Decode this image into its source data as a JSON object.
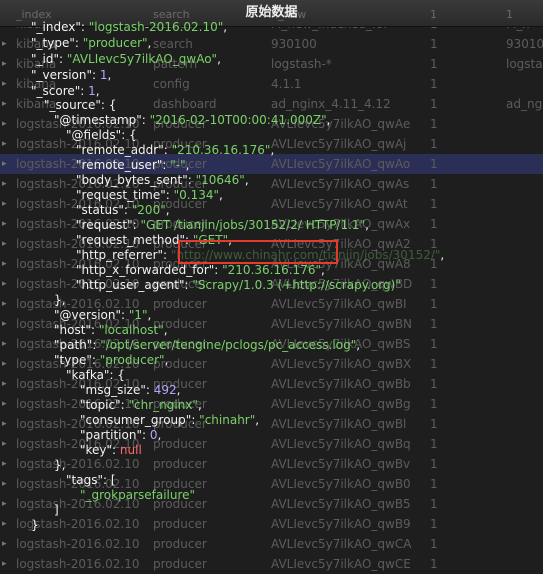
{
  "header": {
    "title": "原始数据",
    "col_index": "_index",
    "col_type": "search",
    "col_id": "h_new",
    "col_version": "1",
    "col_score": "1"
  },
  "table_rows": [
    {
      "index": "kibana",
      "type": "search",
      "id": "M_new_Indexed_for",
      "v": "1",
      "s": "M_x"
    },
    {
      "index": "kibana",
      "type": "search",
      "id": "930100",
      "v": "1",
      "s": "93010"
    },
    {
      "index": "kibana",
      "type": "pattern",
      "id": "logstash-*",
      "v": "1",
      "s": "logstash"
    },
    {
      "index": "kibana",
      "type": "config",
      "id": "4.1.1",
      "v": "1",
      "s": ""
    },
    {
      "index": "kibana",
      "type": "dashboard",
      "id": "ad_nginx_4.11_4.12",
      "v": "1",
      "s": "ad_ngin"
    },
    {
      "index": "logstash-2016.02.10",
      "type": "producer",
      "id": "AVLIevc5y7ilkAO_qwAe",
      "v": "1",
      "s": ""
    },
    {
      "index": "logstash-2016.02.10",
      "type": "producer",
      "id": "AVLIevc5y7ilkAO_qwAj",
      "v": "1",
      "s": ""
    },
    {
      "index": "logstash-2016.02.10",
      "type": "producer",
      "id": "AVLIevc5y7ilkAO_qwAo",
      "v": "1",
      "s": ""
    },
    {
      "index": "logstash-2016.02.10",
      "type": "producer",
      "id": "AVLIevc5y7ilkAO_qwAs",
      "v": "1",
      "s": ""
    },
    {
      "index": "logstash-2016.02.10",
      "type": "producer",
      "id": "AVLIevc5y7ilkAO_qwAt",
      "v": "1",
      "s": ""
    },
    {
      "index": "logstash-2016.02.10",
      "type": "producer",
      "id": "AVLIevc5y7ilkAO_qwAx",
      "v": "1",
      "s": ""
    },
    {
      "index": "logstash-2016.02.10",
      "type": "producer",
      "id": "AVLIevc5y7ilkAO_qwA2",
      "v": "1",
      "s": ""
    },
    {
      "index": "logstash-2016.02.10",
      "type": "producer",
      "id": "AVLIevc5y7ilkAO_qwA8",
      "v": "1",
      "s": ""
    },
    {
      "index": "logstash-2016.02.10",
      "type": "producer",
      "id": "AVLIevc5y7ilkAO_qwBD",
      "v": "1",
      "s": ""
    },
    {
      "index": "logstash-2016.02.10",
      "type": "producer",
      "id": "AVLIevc5y7ilkAO_qwBI",
      "v": "1",
      "s": ""
    },
    {
      "index": "logstash-2016.02.10",
      "type": "producer",
      "id": "AVLIevc5y7ilkAO_qwBN",
      "v": "1",
      "s": ""
    },
    {
      "index": "logstash-2016.02.10",
      "type": "producer",
      "id": "AVLIevc5y7ilkAO_qwBS",
      "v": "1",
      "s": ""
    },
    {
      "index": "logstash-2016.02.10",
      "type": "producer",
      "id": "AVLIevc5y7ilkAO_qwBX",
      "v": "1",
      "s": ""
    },
    {
      "index": "logstash-2016.02.10",
      "type": "producer",
      "id": "AVLIevc5y7ilkAO_qwBb",
      "v": "1",
      "s": ""
    },
    {
      "index": "logstash-2016.02.10",
      "type": "producer",
      "id": "AVLIevc5y7ilkAO_qwBg",
      "v": "1",
      "s": ""
    },
    {
      "index": "logstash-2016.02.10",
      "type": "producer",
      "id": "AVLIevc5y7ilkAO_qwBl",
      "v": "1",
      "s": ""
    },
    {
      "index": "logstash-2016.02.10",
      "type": "producer",
      "id": "AVLIevc5y7ilkAO_qwBq",
      "v": "1",
      "s": ""
    },
    {
      "index": "logstash-2016.02.10",
      "type": "producer",
      "id": "AVLIevc5y7ilkAO_qwBv",
      "v": "1",
      "s": ""
    },
    {
      "index": "logstash-2016.02.10",
      "type": "producer",
      "id": "AVLIevc5y7ilkAO_qwB0",
      "v": "1",
      "s": ""
    },
    {
      "index": "logstash-2016.02.10",
      "type": "producer",
      "id": "AVLIevc5y7ilkAO_qwB5",
      "v": "1",
      "s": ""
    },
    {
      "index": "logstash-2016.02.10",
      "type": "producer",
      "id": "AVLIevc5y7ilkAO_qwB9",
      "v": "1",
      "s": ""
    },
    {
      "index": "logstash-2016.02.10",
      "type": "producer",
      "id": "AVLIevc5y7ilkAO_qwCA",
      "v": "1",
      "s": ""
    },
    {
      "index": "logstash-2016.02.10",
      "type": "producer",
      "id": "AVLIevc5y7ilkAO_qwCE",
      "v": "1",
      "s": ""
    }
  ],
  "json": {
    "index_key": "\"_index\"",
    "index_val": "\"logstash-2016.02.10\"",
    "type_key": "\"_type\"",
    "type_val": "\"producer\"",
    "id_key": "\"_id\"",
    "id_val": "\"AVLIevc5y7ilkAO_qwAo\"",
    "version_key": "\"_version\"",
    "version_val": "1",
    "score_key": "\"_score\"",
    "score_val": "1",
    "source_key": "\"_source\"",
    "timestamp_key": "\"@timestamp\"",
    "timestamp_val": "\"2016-02-10T00:00:41.000Z\"",
    "fields_key": "\"@fields\"",
    "remote_addr_key": "\"remote_addr\"",
    "remote_addr_val": "\"210.36.16.176\"",
    "remote_user_key": "\"remote_user\"",
    "remote_user_val": "\"-\"",
    "body_bytes_key": "\"body_bytes_sent\"",
    "body_bytes_val": "\"10646\"",
    "request_time_key": "\"request_time\"",
    "request_time_val": "\"0.134\"",
    "status_key": "\"status\"",
    "status_val": "\"200\"",
    "request_key": "\"request\"",
    "request_val": "\"GET /tianjin/jobs/30152/2/ HTTP/1.1\"",
    "request_method_key": "\"request_method\"",
    "request_method_val": "\"GET\"",
    "http_referrer_key": "\"http_referrer\"",
    "http_referrer_val": "\"http://www.chinahr.com/tianjin/jobs/30152/\"",
    "xff_key": "\"http_x_forwarded_for\"",
    "xff_val": "\"210.36.16.176\"",
    "ua_key": "\"http_user_agent\"",
    "ua_val": "\"Scrapy/1.0.3 (+http://scrapy.org)\"",
    "at_version_key": "\"@version\"",
    "at_version_val": "\"1\"",
    "host_key": "\"host\"",
    "host_val": "\"localhost\"",
    "path_key": "\"path\"",
    "path_val": "\"/opt/server/tengine/pclogs/pc_access.log\"",
    "src_type_key": "\"type\"",
    "src_type_val": "\"producer\"",
    "kafka_key": "\"kafka\"",
    "msg_size_key": "\"msg_size\"",
    "msg_size_val": "492",
    "topic_key": "\"topic\"",
    "topic_val": "\"chr_nginx\"",
    "consumer_group_key": "\"consumer_group\"",
    "consumer_group_val": "\"chinahr\"",
    "partition_key": "\"partition\"",
    "partition_val": "0",
    "kafka_key_key": "\"key\"",
    "kafka_key_val": "null",
    "tags_key": "\"tags\"",
    "tags_val": "\"_grokparsefailure\""
  },
  "colors": {
    "key": "#f2f2f2",
    "string": "#7bd16b",
    "number": "#b5a4ff",
    "null": "#ff6a6a",
    "highlight_box": "#e53a2c"
  }
}
